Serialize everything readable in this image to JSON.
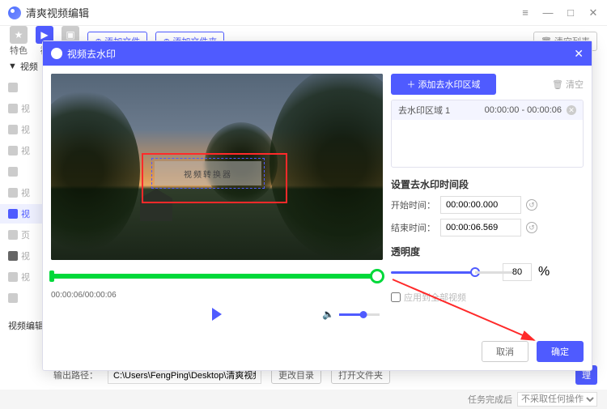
{
  "app": {
    "title": "清爽视频编辑"
  },
  "toolbar": {
    "tab1": "特色",
    "tab2": "视",
    "tab3": "",
    "add_file": "添加文件",
    "add_folder": "添加文件夹",
    "clear_list": "清空列表"
  },
  "sidebar": {
    "section": "视频",
    "items": [
      "",
      "视",
      "视",
      "视",
      "",
      "视",
      "视",
      "页",
      "视",
      "视"
    ],
    "bottom": "视频编辑"
  },
  "bottom": {
    "out_label": "输出路径：",
    "out_path": "C:\\Users\\FengPing\\Desktop\\清爽视频编辑",
    "change_dir": "更改目录",
    "open_folder": "打开文件夹",
    "process": "理"
  },
  "status": {
    "label": "任务完成后",
    "select": "不采取任何操作"
  },
  "modal": {
    "title": "视频去水印",
    "watermark_text": "视频转换器",
    "time_display": "00:00:06/00:00:06",
    "add_region": "＋ 添加去水印区域",
    "clear": "清空",
    "trash_icon": "🗑",
    "region_list": [
      {
        "name": "去水印区域 1",
        "range": "00:00:00 - 00:00:06"
      }
    ],
    "time_section_title": "设置去水印时间段",
    "start_label": "开始时间：",
    "start_value": "00:00:00.000",
    "end_label": "结束时间：",
    "end_value": "00:00:06.569",
    "opacity_label": "透明度",
    "opacity_value": "80",
    "opacity_unit": "%",
    "apply_all": "应用到全部视频",
    "cancel": "取消",
    "confirm": "确定"
  }
}
